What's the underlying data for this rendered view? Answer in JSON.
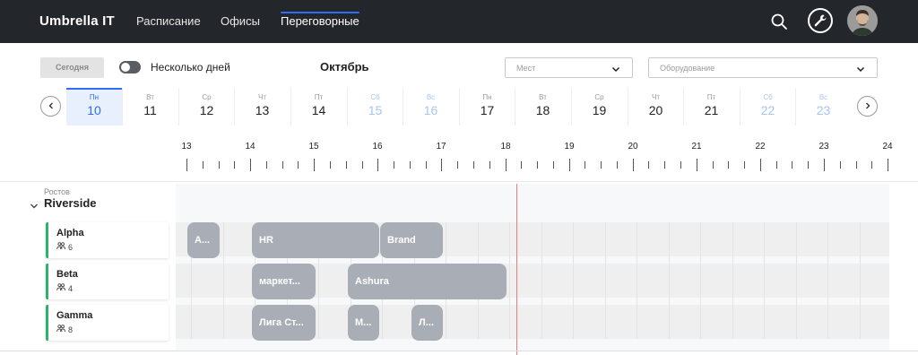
{
  "header": {
    "logo": "Umbrella IT",
    "nav": [
      {
        "label": "Расписание"
      },
      {
        "label": "Офисы"
      },
      {
        "label": "Переговорные"
      }
    ]
  },
  "controls": {
    "today_label": "Сегодня",
    "multi_day_label": "Несколько дней",
    "multi_day_on": false,
    "month": "Октябрь",
    "places_placeholder": "Мест",
    "equipment_placeholder": "Оборудование"
  },
  "days": [
    {
      "dow": "Пн",
      "date": "10"
    },
    {
      "dow": "Вт",
      "date": "11"
    },
    {
      "dow": "Ср",
      "date": "12"
    },
    {
      "dow": "Чт",
      "date": "13"
    },
    {
      "dow": "Пт",
      "date": "14"
    },
    {
      "dow": "Сб",
      "date": "15"
    },
    {
      "dow": "Вс",
      "date": "16"
    },
    {
      "dow": "Пн",
      "date": "17"
    },
    {
      "dow": "Вт",
      "date": "18"
    },
    {
      "dow": "Ср",
      "date": "19"
    },
    {
      "dow": "Чт",
      "date": "20"
    },
    {
      "dow": "Пт",
      "date": "21"
    },
    {
      "dow": "Сб",
      "date": "22"
    },
    {
      "dow": "Вс",
      "date": "23"
    }
  ],
  "hours": [
    "13",
    "14",
    "15",
    "16",
    "17",
    "18",
    "19",
    "20",
    "21",
    "22",
    "23",
    "24"
  ],
  "office": {
    "city": "Ростов",
    "name": "Riverside"
  },
  "rooms": [
    {
      "name": "Alpha",
      "capacity": "6"
    },
    {
      "name": "Beta",
      "capacity": "4"
    },
    {
      "name": "Gamma",
      "capacity": "8"
    }
  ],
  "events": [
    {
      "title": "A..."
    },
    {
      "title": "HR"
    },
    {
      "title": "Brand"
    },
    {
      "title": "маркет..."
    },
    {
      "title": "Ashura"
    },
    {
      "title": "Лига Ст..."
    },
    {
      "title": "М..."
    },
    {
      "title": "Л..."
    }
  ],
  "colors": {
    "accent": "#2f6df6",
    "event": "#a9aeb6",
    "room_status": "#2fb36a",
    "now_line": "#f07a7a",
    "header_bg": "#23262b"
  }
}
